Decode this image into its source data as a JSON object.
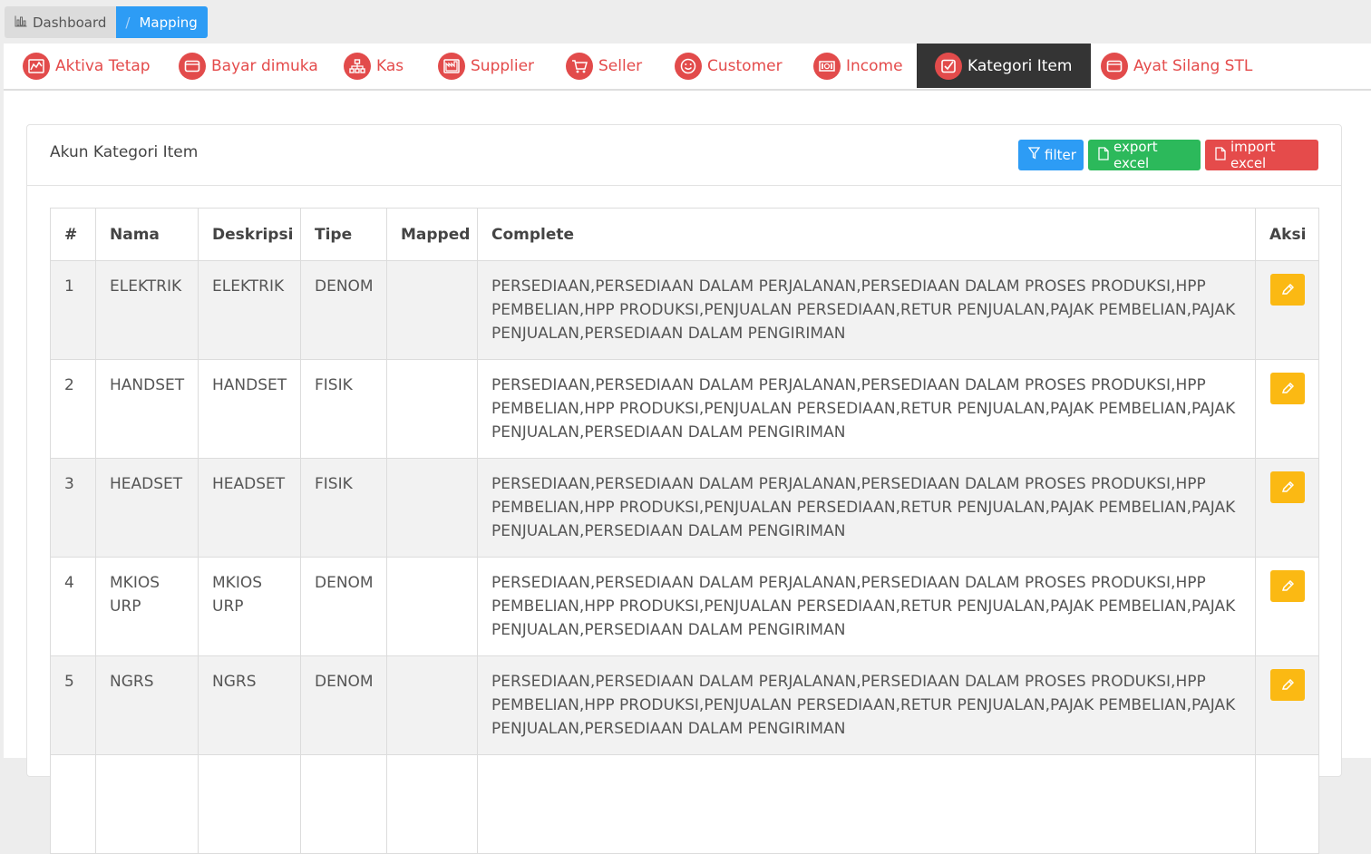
{
  "breadcrumb": {
    "items": [
      {
        "label": "Dashboard"
      },
      {
        "separator": "/",
        "label": "Mapping"
      }
    ]
  },
  "tabs": [
    {
      "label": "Aktiva Tetap",
      "icon": "chart-icon",
      "active": false
    },
    {
      "label": "Bayar dimuka",
      "icon": "wallet-icon",
      "active": false
    },
    {
      "label": "Kas",
      "icon": "sitemap-icon",
      "active": false
    },
    {
      "label": "Supplier",
      "icon": "factory-icon",
      "active": false
    },
    {
      "label": "Seller",
      "icon": "cart-icon",
      "active": false
    },
    {
      "label": "Customer",
      "icon": "smile-icon",
      "active": false
    },
    {
      "label": "Income",
      "icon": "money-icon",
      "active": false
    },
    {
      "label": "Kategori Item",
      "icon": "checkbox-icon",
      "active": true
    },
    {
      "label": "Ayat Silang STL",
      "icon": "wallet-icon",
      "active": false
    }
  ],
  "card": {
    "title": "Akun Kategori Item",
    "buttons": {
      "filter": "filter",
      "export": "export excel",
      "import": "import excel"
    }
  },
  "table": {
    "headers": [
      "#",
      "Nama",
      "Deskripsi",
      "Tipe",
      "Mapped",
      "Complete",
      "Aksi"
    ],
    "rows": [
      {
        "no": "1",
        "nama": "ELEKTRIK",
        "deskripsi": "ELEKTRIK",
        "tipe": "DENOM",
        "mapped": "",
        "complete": "PERSEDIAAN,PERSEDIAAN DALAM PERJALANAN,PERSEDIAAN DALAM PROSES PRODUKSI,HPP PEMBELIAN,HPP PRODUKSI,PENJUALAN PERSEDIAAN,RETUR PENJUALAN,PAJAK PEMBELIAN,PAJAK PENJUALAN,PERSEDIAAN DALAM PENGIRIMAN"
      },
      {
        "no": "2",
        "nama": "HANDSET",
        "deskripsi": "HANDSET",
        "tipe": "FISIK",
        "mapped": "",
        "complete": "PERSEDIAAN,PERSEDIAAN DALAM PERJALANAN,PERSEDIAAN DALAM PROSES PRODUKSI,HPP PEMBELIAN,HPP PRODUKSI,PENJUALAN PERSEDIAAN,RETUR PENJUALAN,PAJAK PEMBELIAN,PAJAK PENJUALAN,PERSEDIAAN DALAM PENGIRIMAN"
      },
      {
        "no": "3",
        "nama": "HEADSET",
        "deskripsi": "HEADSET",
        "tipe": "FISIK",
        "mapped": "",
        "complete": "PERSEDIAAN,PERSEDIAAN DALAM PERJALANAN,PERSEDIAAN DALAM PROSES PRODUKSI,HPP PEMBELIAN,HPP PRODUKSI,PENJUALAN PERSEDIAAN,RETUR PENJUALAN,PAJAK PEMBELIAN,PAJAK PENJUALAN,PERSEDIAAN DALAM PENGIRIMAN"
      },
      {
        "no": "4",
        "nama": "MKIOS URP",
        "deskripsi": "MKIOS URP",
        "tipe": "DENOM",
        "mapped": "",
        "complete": "PERSEDIAAN,PERSEDIAAN DALAM PERJALANAN,PERSEDIAAN DALAM PROSES PRODUKSI,HPP PEMBELIAN,HPP PRODUKSI,PENJUALAN PERSEDIAAN,RETUR PENJUALAN,PAJAK PEMBELIAN,PAJAK PENJUALAN,PERSEDIAAN DALAM PENGIRIMAN"
      },
      {
        "no": "5",
        "nama": "NGRS",
        "deskripsi": "NGRS",
        "tipe": "DENOM",
        "mapped": "",
        "complete": "PERSEDIAAN,PERSEDIAAN DALAM PERJALANAN,PERSEDIAAN DALAM PROSES PRODUKSI,HPP PEMBELIAN,HPP PRODUKSI,PENJUALAN PERSEDIAAN,RETUR PENJUALAN,PAJAK PEMBELIAN,PAJAK PENJUALAN,PERSEDIAAN DALAM PENGIRIMAN"
      },
      {
        "no": "",
        "nama": "",
        "deskripsi": "",
        "tipe": "",
        "mapped": "",
        "complete": ""
      }
    ]
  },
  "colors": {
    "accent_blue": "#2d9cf5",
    "tab_red": "#e24b4b",
    "active_tab_bg": "#343434",
    "export_green": "#2cb95b",
    "import_red": "#e54b4b",
    "edit_yellow": "#fbb913"
  }
}
